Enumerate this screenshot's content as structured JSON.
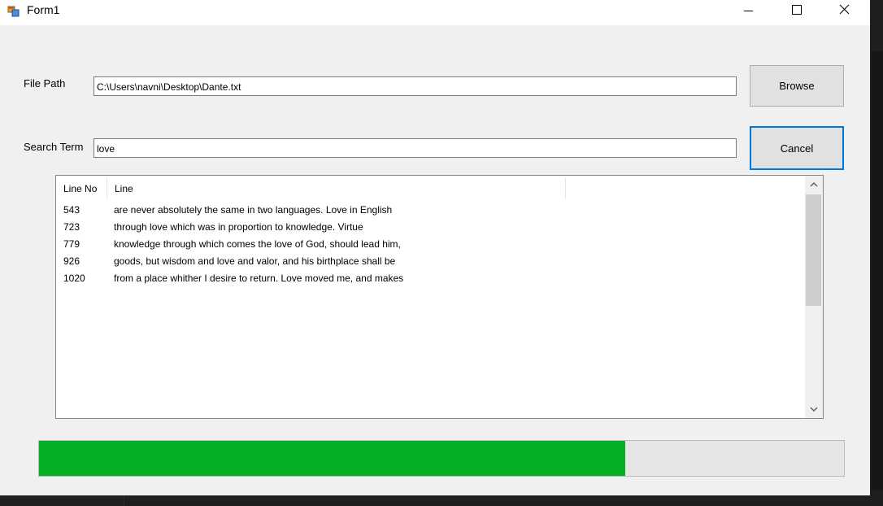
{
  "window": {
    "title": "Form1",
    "icons": {
      "app": "form-app-icon",
      "minimize": "minimize-icon",
      "maximize": "maximize-icon",
      "close": "close-icon"
    }
  },
  "form": {
    "file_path_label": "File Path",
    "file_path_value": "C:\\Users\\navni\\Desktop\\Dante.txt",
    "browse_label": "Browse",
    "search_term_label": "Search Term",
    "search_term_value": "love",
    "cancel_label": "Cancel"
  },
  "results": {
    "columns": [
      "Line No",
      "Line"
    ],
    "rows": [
      {
        "line_no": "543",
        "line": "are never absolutely the same in two languages. Love in English"
      },
      {
        "line_no": "723",
        "line": "through love which was in proportion to knowledge. Virtue"
      },
      {
        "line_no": "779",
        "line": "knowledge through which comes the love of God, should lead him,"
      },
      {
        "line_no": "926",
        "line": "goods, but wisdom and love and valor, and his birthplace shall be"
      },
      {
        "line_no": "1020",
        "line": "from a place whither I desire to return. Love moved me, and makes"
      }
    ],
    "scroll_icons": {
      "up": "chevron-up-icon",
      "down": "chevron-down-icon"
    }
  },
  "progress": {
    "fraction": 0.728,
    "fill_color": "#06b025"
  }
}
